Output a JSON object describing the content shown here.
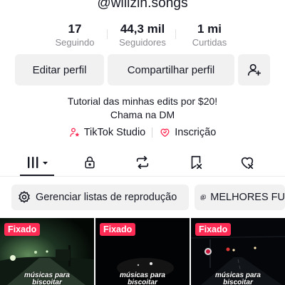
{
  "profile": {
    "username": "@willzin.songs",
    "bio_line1": "Tutorial das minhas edits por $20!",
    "bio_line2": "Chama na DM"
  },
  "stats": [
    {
      "value": "17",
      "label": "Seguindo"
    },
    {
      "value": "44,3 mil",
      "label": "Seguidores"
    },
    {
      "value": "1 mi",
      "label": "Curtidas"
    }
  ],
  "actions": {
    "edit_label": "Editar perfil",
    "share_label": "Compartilhar perfil",
    "add_friend_icon": "add-user-icon"
  },
  "links": {
    "studio_label": "TikTok Studio",
    "subscription_label": "Inscrição",
    "accent_color": "#fe2c55"
  },
  "tabs": {
    "items": [
      {
        "icon": "grid-icon",
        "active": true
      },
      {
        "icon": "lock-icon",
        "active": false
      },
      {
        "icon": "repost-icon",
        "active": false
      },
      {
        "icon": "favorites-icon",
        "active": false
      },
      {
        "icon": "liked-icon",
        "active": false
      }
    ]
  },
  "playlists": {
    "manage_label": "Gerenciar listas de reprodução",
    "playlist1_label": "MELHORES FU"
  },
  "videos": [
    {
      "badge": "Fixado",
      "caption_line1": "músicas para",
      "caption_line2": "biscoitar"
    },
    {
      "badge": "Fixado",
      "caption_line1": "músicas para",
      "caption_line2": "biscoitar"
    },
    {
      "badge": "Fixado",
      "caption_line1": "músicas para",
      "caption_line2": "biscoitar"
    }
  ]
}
